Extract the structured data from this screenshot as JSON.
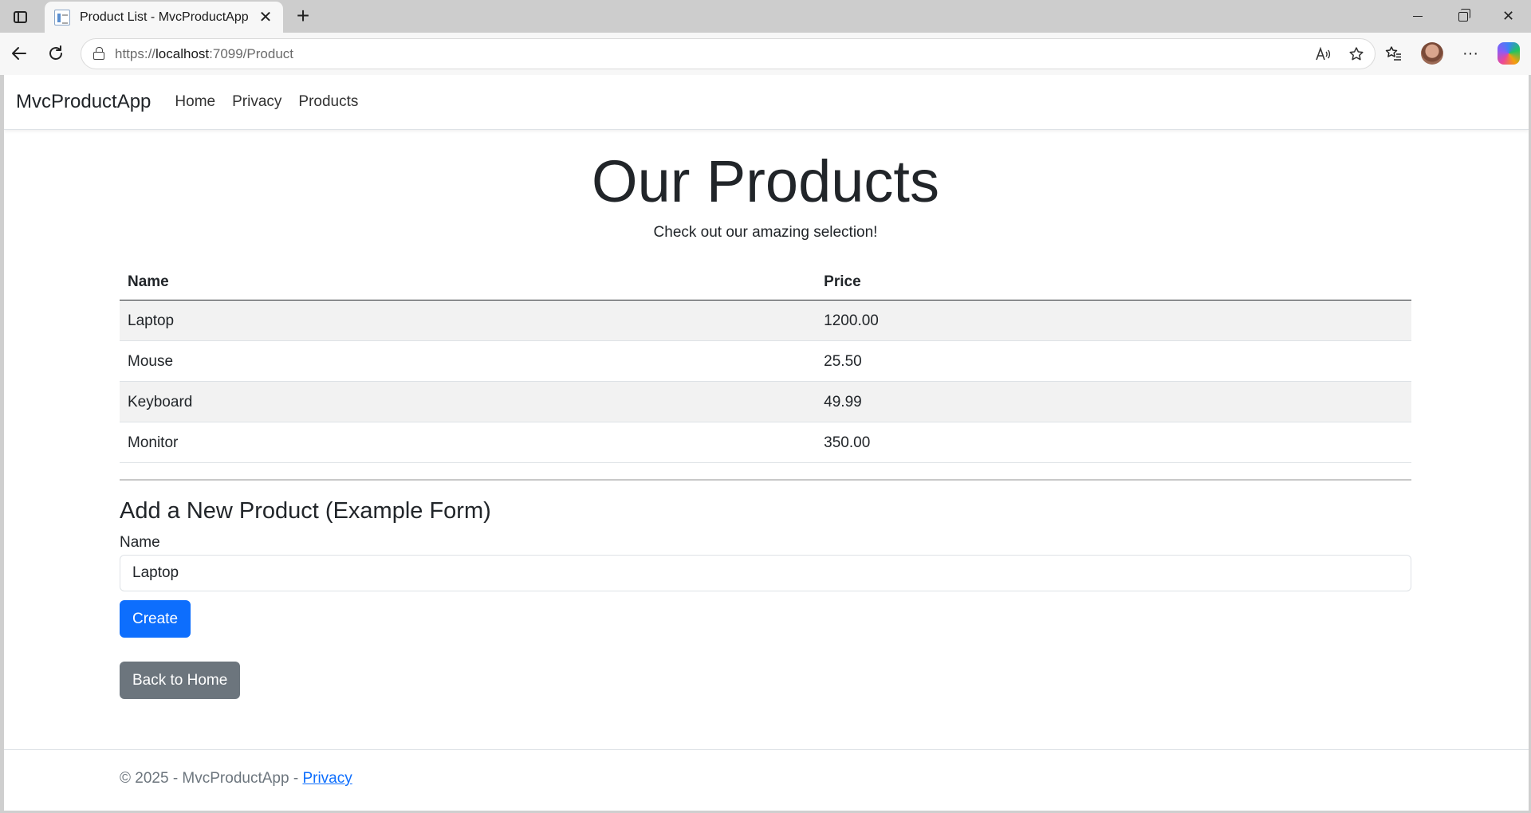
{
  "browser": {
    "tab_title": "Product List - MvcProductApp",
    "url_scheme": "https://",
    "url_host": "localhost",
    "url_rest": ":7099/Product",
    "icons": [
      "sidebar-toggle-icon",
      "favicon",
      "close-icon",
      "plus-icon",
      "back-icon",
      "reload-icon",
      "lock-icon",
      "read-aloud-icon",
      "star-icon",
      "favorites-icon",
      "avatar",
      "more-icon",
      "copilot-icon",
      "minimize-icon",
      "restore-icon",
      "close-window-icon"
    ]
  },
  "site": {
    "brand": "MvcProductApp",
    "nav": [
      {
        "label": "Home"
      },
      {
        "label": "Privacy"
      },
      {
        "label": "Products"
      }
    ]
  },
  "main": {
    "title": "Our Products",
    "subtitle": "Check out our amazing selection!",
    "table": {
      "headers": [
        "Name",
        "Price"
      ],
      "rows": [
        {
          "name": "Laptop",
          "price": "1200.00"
        },
        {
          "name": "Mouse",
          "price": "25.50"
        },
        {
          "name": "Keyboard",
          "price": "49.99"
        },
        {
          "name": "Monitor",
          "price": "350.00"
        }
      ]
    },
    "form": {
      "title": "Add a New Product (Example Form)",
      "name_label": "Name",
      "name_value": "Laptop",
      "create_label": "Create"
    },
    "back_label": "Back to Home"
  },
  "footer": {
    "text": "© 2025 - MvcProductApp - ",
    "link": "Privacy"
  },
  "colors": {
    "primary": "#0d6efd",
    "secondary": "#6c757d",
    "striped_row": "#f2f2f2"
  }
}
